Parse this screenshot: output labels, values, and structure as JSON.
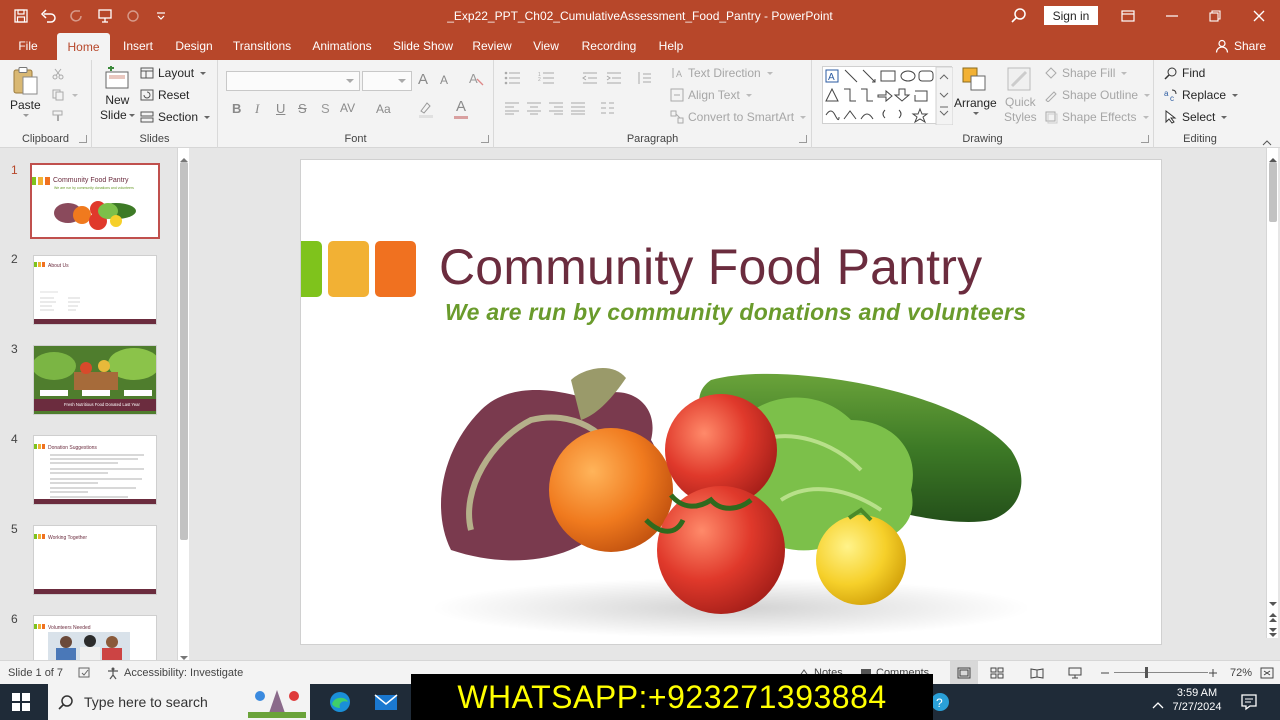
{
  "window": {
    "title": "_Exp22_PPT_Ch02_CumulativeAssessment_Food_Pantry  -  PowerPoint",
    "sign_in": "Sign in"
  },
  "tabs": [
    "File",
    "Home",
    "Insert",
    "Design",
    "Transitions",
    "Animations",
    "Slide Show",
    "Review",
    "View",
    "Recording",
    "Help"
  ],
  "active_tab": "Home",
  "share": "Share",
  "ribbon": {
    "clipboard": {
      "label": "Clipboard",
      "paste": "Paste"
    },
    "slides": {
      "label": "Slides",
      "new_slide_1": "New",
      "new_slide_2": "Slide",
      "layout": "Layout",
      "reset": "Reset",
      "section": "Section"
    },
    "font": {
      "label": "Font",
      "bold": "B",
      "italic": "I",
      "underline": "U",
      "strike": "S",
      "spacing": "AV",
      "case": "Aa",
      "color": "A",
      "grow": "A",
      "shrink": "A"
    },
    "paragraph": {
      "label": "Paragraph",
      "text_direction": "Text Direction",
      "align_text": "Align Text",
      "smartart": "Convert to SmartArt"
    },
    "drawing": {
      "label": "Drawing",
      "arrange": "Arrange",
      "quick_styles_1": "Quick",
      "quick_styles_2": "Styles",
      "shape_fill": "Shape Fill",
      "shape_outline": "Shape Outline",
      "shape_effects": "Shape Effects"
    },
    "editing": {
      "label": "Editing",
      "find": "Find",
      "replace": "Replace",
      "select": "Select"
    }
  },
  "thumbnails": [
    {
      "num": "1",
      "title": "Community Food Pantry",
      "subtitle": "We are run by community donations and volunteers"
    },
    {
      "num": "2",
      "title": "About Us"
    },
    {
      "num": "3",
      "title": "Fresh Nutritious Food Donated Last Year"
    },
    {
      "num": "4",
      "title": "Donation Suggestions"
    },
    {
      "num": "5",
      "title": "Working Together"
    },
    {
      "num": "6",
      "title": "Volunteers Needed"
    }
  ],
  "slide": {
    "title": "Community Food Pantry",
    "subtitle": "We are run by community donations and volunteers",
    "colors": {
      "title": "#6b2c3e",
      "subtitle": "#6a9b2c",
      "sq1": "#7fc31c",
      "sq2": "#f2b134",
      "sq3": "#f07120"
    }
  },
  "status": {
    "slide_count": "Slide 1 of 7",
    "accessibility": "Accessibility: Investigate",
    "notes": "Notes",
    "comments": "Comments",
    "zoom": "72%"
  },
  "taskbar": {
    "search_placeholder": "Type here to search",
    "time": "3:59 AM",
    "date": "7/27/2024"
  },
  "overlay": "WHATSAPP:+923271393884"
}
